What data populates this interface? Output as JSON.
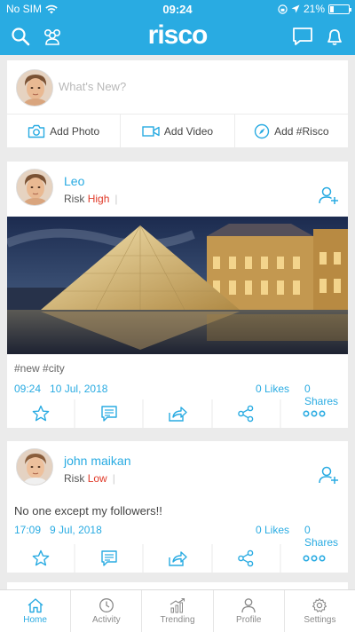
{
  "status_bar": {
    "carrier": "No SIM",
    "time": "09:24",
    "battery": "21%",
    "battery_level": 0.21
  },
  "header": {
    "logo": "risco",
    "icons": [
      "search-icon",
      "group-icon",
      "chat-icon",
      "bell-icon"
    ]
  },
  "composer": {
    "placeholder": "What's New?",
    "actions": [
      {
        "label": "Add Photo",
        "icon": "camera-icon"
      },
      {
        "label": "Add Video",
        "icon": "video-icon"
      },
      {
        "label": "Add #Risco",
        "icon": "compass-icon"
      }
    ]
  },
  "posts": [
    {
      "name": "Leo",
      "risk_label": "Risk",
      "risk_level": "High",
      "text": "#new #city",
      "time": "09:24",
      "date": "10 Jul, 2018",
      "likes": "0 Likes",
      "shares": "0 Shares"
    },
    {
      "name": "john maikan",
      "risk_label": "Risk",
      "risk_level": "Low",
      "text": "No one except my followers!!",
      "time": "17:09",
      "date": "9 Jul, 2018",
      "likes": "0 Likes",
      "shares": "0 Shares"
    }
  ],
  "post_actions": [
    "star-icon",
    "comment-icon",
    "forward-icon",
    "share-icon",
    "more-icon"
  ],
  "tabs": [
    {
      "label": "Home",
      "icon": "home-icon",
      "active": true
    },
    {
      "label": "Activity",
      "icon": "clock-icon",
      "active": false
    },
    {
      "label": "Trending",
      "icon": "trending-icon",
      "active": false
    },
    {
      "label": "Profile",
      "icon": "person-icon",
      "active": false
    },
    {
      "label": "Settings",
      "icon": "gear-icon",
      "active": false
    }
  ],
  "colors": {
    "accent": "#29abe2",
    "risk": "#e03b2a",
    "background": "#ebebeb"
  }
}
